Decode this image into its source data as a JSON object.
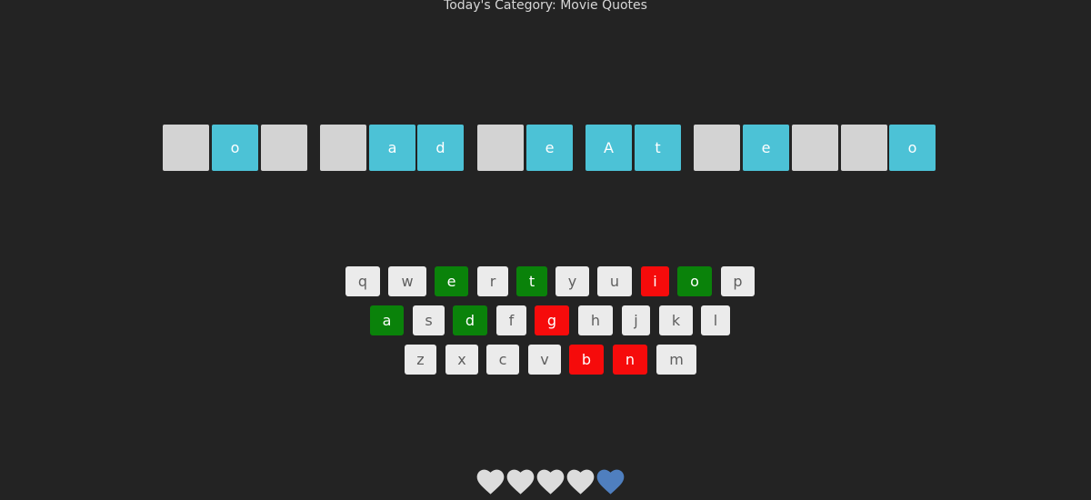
{
  "header": {
    "category_text": "Today's Category: Movie Quotes"
  },
  "colors": {
    "background": "#232323",
    "tile_hidden": "#d3d3d3",
    "tile_revealed": "#4cc2d6",
    "key_default": "#ebebeb",
    "key_correct": "#0a820a",
    "key_wrong": "#f60b0b",
    "heart_lost": "#dcdcdc",
    "heart_remaining": "#4f7fbf"
  },
  "puzzle": {
    "tiles": [
      {
        "letter": "",
        "revealed": false
      },
      {
        "letter": "o",
        "revealed": true
      },
      {
        "letter": "",
        "revealed": false
      },
      {
        "letter": "",
        "revealed": false
      },
      {
        "letter": "a",
        "revealed": true
      },
      {
        "letter": "d",
        "revealed": true
      },
      {
        "letter": "",
        "revealed": false
      },
      {
        "letter": "e",
        "revealed": true
      },
      {
        "letter": "A",
        "revealed": true
      },
      {
        "letter": "t",
        "revealed": true
      },
      {
        "letter": "",
        "revealed": false
      },
      {
        "letter": "e",
        "revealed": true
      },
      {
        "letter": "",
        "revealed": false
      },
      {
        "letter": "",
        "revealed": false
      },
      {
        "letter": "o",
        "revealed": true
      }
    ]
  },
  "keyboard": {
    "row1": [
      {
        "key": "q",
        "state": "default"
      },
      {
        "key": "w",
        "state": "default"
      },
      {
        "key": "e",
        "state": "correct"
      },
      {
        "key": "r",
        "state": "default"
      },
      {
        "key": "t",
        "state": "correct"
      },
      {
        "key": "y",
        "state": "default"
      },
      {
        "key": "u",
        "state": "default"
      },
      {
        "key": "i",
        "state": "wrong"
      },
      {
        "key": "o",
        "state": "correct"
      },
      {
        "key": "p",
        "state": "default"
      }
    ],
    "row2": [
      {
        "key": "a",
        "state": "correct"
      },
      {
        "key": "s",
        "state": "default"
      },
      {
        "key": "d",
        "state": "correct"
      },
      {
        "key": "f",
        "state": "default"
      },
      {
        "key": "g",
        "state": "wrong"
      },
      {
        "key": "h",
        "state": "default"
      },
      {
        "key": "j",
        "state": "default"
      },
      {
        "key": "k",
        "state": "default"
      },
      {
        "key": "l",
        "state": "default"
      }
    ],
    "row3": [
      {
        "key": "z",
        "state": "default"
      },
      {
        "key": "x",
        "state": "default"
      },
      {
        "key": "c",
        "state": "default"
      },
      {
        "key": "v",
        "state": "default"
      },
      {
        "key": "b",
        "state": "wrong"
      },
      {
        "key": "n",
        "state": "wrong"
      },
      {
        "key": "m",
        "state": "default"
      }
    ]
  },
  "lives": {
    "hearts": [
      {
        "icon": "heart-icon",
        "state": "lost"
      },
      {
        "icon": "heart-icon",
        "state": "lost"
      },
      {
        "icon": "heart-icon",
        "state": "lost"
      },
      {
        "icon": "heart-icon",
        "state": "lost"
      },
      {
        "icon": "heart-icon",
        "state": "remaining"
      }
    ],
    "remaining": 1,
    "total": 5
  }
}
